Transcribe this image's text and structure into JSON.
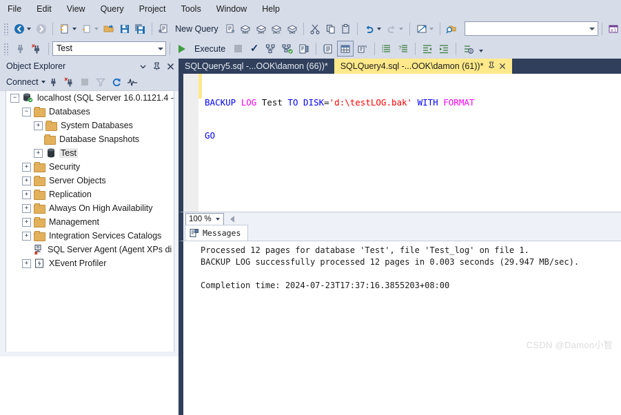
{
  "menu": {
    "items": [
      "File",
      "Edit",
      "View",
      "Query",
      "Project",
      "Tools",
      "Window",
      "Help"
    ]
  },
  "toolbar_main": {
    "new_query_label": "New Query",
    "icons": [
      "navigate-back-icon",
      "navigate-forward-icon",
      "new-project-icon",
      "new-item-icon",
      "open-file-icon",
      "save-icon",
      "save-all-icon",
      "new-query-icon",
      "new-analysis-query-icon",
      "new-mdx-query-icon",
      "new-dmx-query-icon",
      "new-xmla-query-icon",
      "new-dax-query-icon",
      "cut-icon",
      "copy-icon",
      "paste-icon",
      "undo-icon",
      "redo-icon",
      "navigate-to-icon",
      "find-in-files-icon"
    ],
    "search_value": "",
    "search_placeholder": ""
  },
  "toolbar_query": {
    "database_value": "Test",
    "execute_label": "Execute",
    "icons": [
      "connect-icon",
      "change-connection-icon",
      "stop-icon",
      "parse-icon",
      "display-estimated-plan-icon",
      "include-actual-plan-icon",
      "include-client-statistics-icon",
      "results-to-text-icon",
      "results-to-grid-icon",
      "results-to-file-icon",
      "comment-icon",
      "uncomment-icon",
      "decrease-indent-icon",
      "increase-indent-icon",
      "specify-values-icon"
    ]
  },
  "object_explorer": {
    "title": "Object Explorer",
    "header_buttons": [
      "chevron-down-icon",
      "pin-icon",
      "close-icon"
    ],
    "connect_label": "Connect",
    "toolbar_icons": [
      "connect-plug-icon",
      "disconnect-plug-icon",
      "stop-icon",
      "filter-icon",
      "refresh-icon",
      "activity-monitor-icon"
    ],
    "tree": [
      {
        "label": "localhost (SQL Server 16.0.1121.4 -",
        "indent": 0,
        "expander": "minus",
        "icon": "server-icon",
        "selected": false
      },
      {
        "label": "Databases",
        "indent": 1,
        "expander": "minus",
        "icon": "folder-icon",
        "selected": false
      },
      {
        "label": "System Databases",
        "indent": 2,
        "expander": "plus",
        "icon": "folder-icon",
        "selected": false
      },
      {
        "label": "Database Snapshots",
        "indent": 2,
        "expander": "none",
        "icon": "folder-icon",
        "selected": false
      },
      {
        "label": "Test",
        "indent": 2,
        "expander": "plus",
        "icon": "database-icon",
        "selected": true
      },
      {
        "label": "Security",
        "indent": 1,
        "expander": "plus",
        "icon": "folder-icon",
        "selected": false
      },
      {
        "label": "Server Objects",
        "indent": 1,
        "expander": "plus",
        "icon": "folder-icon",
        "selected": false
      },
      {
        "label": "Replication",
        "indent": 1,
        "expander": "plus",
        "icon": "folder-icon",
        "selected": false
      },
      {
        "label": "Always On High Availability",
        "indent": 1,
        "expander": "plus",
        "icon": "folder-icon",
        "selected": false
      },
      {
        "label": "Management",
        "indent": 1,
        "expander": "plus",
        "icon": "folder-icon",
        "selected": false
      },
      {
        "label": "Integration Services Catalogs",
        "indent": 1,
        "expander": "plus",
        "icon": "folder-icon",
        "selected": false
      },
      {
        "label": "SQL Server Agent (Agent XPs di",
        "indent": 1,
        "expander": "none",
        "icon": "agent-disabled-icon",
        "selected": false
      },
      {
        "label": "XEvent Profiler",
        "indent": 1,
        "expander": "plus",
        "icon": "xevent-icon",
        "selected": false
      }
    ]
  },
  "editor": {
    "tabs": [
      {
        "label": "SQLQuery5.sql -...OOK\\damon (66))*",
        "active": false
      },
      {
        "label": "SQLQuery4.sql -...OOK\\damon (61))*",
        "active": true
      }
    ],
    "active_tab_buttons": [
      "pin-icon",
      "close-icon"
    ],
    "code_line1": [
      {
        "t": "BACKUP",
        "c": "k"
      },
      {
        "t": " ",
        "c": "p"
      },
      {
        "t": "LOG",
        "c": "m"
      },
      {
        "t": " Test ",
        "c": "p"
      },
      {
        "t": "TO",
        "c": "k"
      },
      {
        "t": " ",
        "c": "p"
      },
      {
        "t": "DISK",
        "c": "k"
      },
      {
        "t": "=",
        "c": "p"
      },
      {
        "t": "'d:\\testLOG.bak'",
        "c": "s"
      },
      {
        "t": " ",
        "c": "p"
      },
      {
        "t": "WITH",
        "c": "k"
      },
      {
        "t": " ",
        "c": "p"
      },
      {
        "t": "FORMAT",
        "c": "m"
      }
    ],
    "code_line2": "GO",
    "zoom_value": "100 %"
  },
  "results": {
    "tab_label": "Messages",
    "tab_icon": "messages-icon",
    "messages": "Processed 12 pages for database 'Test', file 'Test_log' on file 1.\nBACKUP LOG successfully processed 12 pages in 0.003 seconds (29.947 MB/sec).\n\nCompletion time: 2024-07-23T17:37:16.3855203+08:00"
  },
  "watermark": {
    "text": "CSDN @Damon小智"
  },
  "colors": {
    "chrome": "#d6dce8",
    "tab_active": "#ffe98a",
    "tab_inactive_bg": "#2f3f5c",
    "keyword": "#0000ff",
    "magenta_keyword": "#ff00ff",
    "string": "#ff0000",
    "execute_green": "#3f9e3f"
  }
}
